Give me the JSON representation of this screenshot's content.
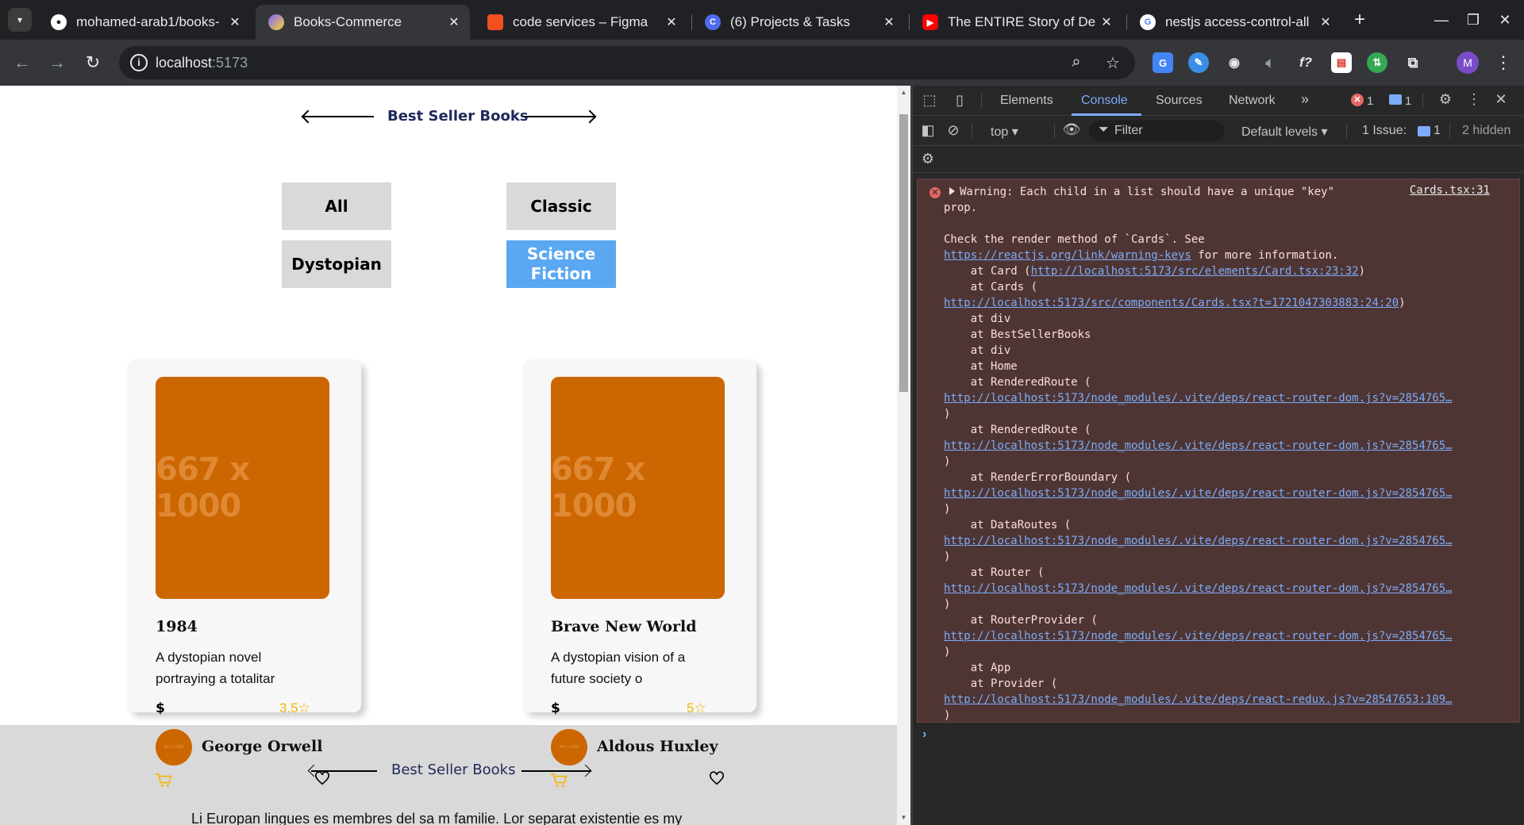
{
  "browser": {
    "tabs": [
      {
        "title": "mohamed-arab1/books-",
        "favicon": "github-icon",
        "active": false
      },
      {
        "title": "Books-Commerce",
        "favicon": "vite-icon",
        "active": true
      },
      {
        "title": "code services – Figma",
        "favicon": "figma-icon",
        "active": false
      },
      {
        "title": "(6) Projects & Tasks",
        "favicon": "clickup-icon",
        "active": false
      },
      {
        "title": "The ENTIRE Story of Dex",
        "favicon": "youtube-icon",
        "active": false
      },
      {
        "title": "nestjs access-control-all",
        "favicon": "google-icon",
        "active": false
      }
    ],
    "url_host": "localhost",
    "url_port": ":5173",
    "profile_initial": "M"
  },
  "page": {
    "section_title": "Best Seller Books",
    "filters": [
      {
        "label": "All",
        "active": false
      },
      {
        "label": "Classic",
        "active": false
      },
      {
        "label": "Dystopian",
        "active": false
      },
      {
        "label": "Science Fiction",
        "active": true
      }
    ],
    "books": [
      {
        "cover_text": "667 x 1000",
        "title": "1984",
        "description": "A dystopian novel portraying a totalitar",
        "price_symbol": "$",
        "rating": "3.5",
        "author": "George Orwell",
        "avatar_text": "667 x 1000"
      },
      {
        "cover_text": "667 x 1000",
        "title": "Brave New World",
        "description": "A dystopian vision of a future society o",
        "price_symbol": "$",
        "rating": "5",
        "author": "Aldous Huxley",
        "avatar_text": "667 x 1000"
      }
    ],
    "footer_title": "Best Seller Books",
    "footer_text": "Li Europan lingues es membres del sa m familie. Lor separat existentie es my"
  },
  "devtools": {
    "tabs": [
      "Elements",
      "Console",
      "Sources",
      "Network"
    ],
    "active_tab": "Console",
    "error_count": "1",
    "message_count": "1",
    "context": "top",
    "filter_placeholder": "Filter",
    "levels": "Default levels",
    "issues_label": "1 Issue:",
    "issues_count": "1",
    "hidden_label": "2 hidden",
    "message": {
      "source_link": "Cards.tsx:31",
      "lines": [
        {
          "text": "Warning: Each child in a list should have a unique \"key\"",
          "link": ""
        },
        {
          "text": "prop.",
          "link": ""
        },
        {
          "text": "",
          "link": ""
        },
        {
          "text": "Check the render method of `Cards`. See",
          "link": ""
        },
        {
          "text": "",
          "link": "https://reactjs.org/link/warning-keys",
          "after": " for more information."
        },
        {
          "text": "    at Card (",
          "link": "http://localhost:5173/src/elements/Card.tsx:23:32",
          "after": ")"
        },
        {
          "text": "    at Cards (",
          "link": "",
          "after": ""
        },
        {
          "text": "",
          "link": "http://localhost:5173/src/components/Cards.tsx?t=1721047303883:24:20",
          "after": ")"
        },
        {
          "text": "    at div",
          "link": ""
        },
        {
          "text": "    at BestSellerBooks",
          "link": ""
        },
        {
          "text": "    at div",
          "link": ""
        },
        {
          "text": "    at Home",
          "link": ""
        },
        {
          "text": "    at RenderedRoute (",
          "link": ""
        },
        {
          "text": "",
          "link": "http://localhost:5173/node_modules/.vite/deps/react-router-dom.js?v=2854765…"
        },
        {
          "text": ")",
          "link": ""
        },
        {
          "text": "    at RenderedRoute (",
          "link": ""
        },
        {
          "text": "",
          "link": "http://localhost:5173/node_modules/.vite/deps/react-router-dom.js?v=2854765…"
        },
        {
          "text": ")",
          "link": ""
        },
        {
          "text": "    at RenderErrorBoundary (",
          "link": ""
        },
        {
          "text": "",
          "link": "http://localhost:5173/node_modules/.vite/deps/react-router-dom.js?v=2854765…"
        },
        {
          "text": ")",
          "link": ""
        },
        {
          "text": "    at DataRoutes (",
          "link": ""
        },
        {
          "text": "",
          "link": "http://localhost:5173/node_modules/.vite/deps/react-router-dom.js?v=2854765…"
        },
        {
          "text": ")",
          "link": ""
        },
        {
          "text": "    at Router (",
          "link": ""
        },
        {
          "text": "",
          "link": "http://localhost:5173/node_modules/.vite/deps/react-router-dom.js?v=2854765…"
        },
        {
          "text": ")",
          "link": ""
        },
        {
          "text": "    at RouterProvider (",
          "link": ""
        },
        {
          "text": "",
          "link": "http://localhost:5173/node_modules/.vite/deps/react-router-dom.js?v=2854765…"
        },
        {
          "text": ")",
          "link": ""
        },
        {
          "text": "    at App",
          "link": ""
        },
        {
          "text": "    at Provider (",
          "link": ""
        },
        {
          "text": "",
          "link": "http://localhost:5173/node_modules/.vite/deps/react-redux.js?v=28547653:109…"
        },
        {
          "text": ")",
          "link": ""
        }
      ]
    }
  },
  "colors": {
    "accent_active_filter": "#5aa8f2",
    "cover": "#cc6600",
    "rating": "#f4b400",
    "console_error_bg": "#4e3534",
    "link": "#7cacf8"
  }
}
